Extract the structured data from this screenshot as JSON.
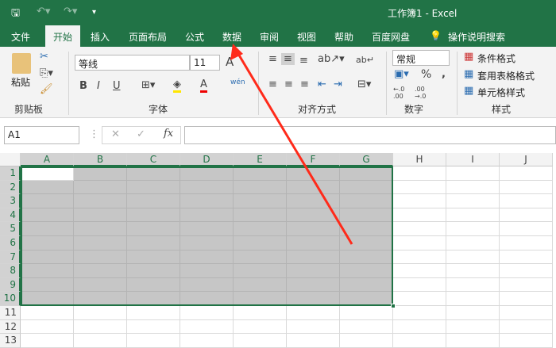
{
  "title": "工作簿1  -  Excel",
  "quick_access": {
    "save_icon": "save-icon",
    "undo_icon": "undo-icon",
    "redo_icon": "redo-icon",
    "customize": "₹"
  },
  "tabs": [
    {
      "label": "文件"
    },
    {
      "label": "开始",
      "active": true
    },
    {
      "label": "插入"
    },
    {
      "label": "页面布局"
    },
    {
      "label": "公式"
    },
    {
      "label": "数据"
    },
    {
      "label": "审阅"
    },
    {
      "label": "视图"
    },
    {
      "label": "帮助"
    },
    {
      "label": "百度网盘"
    },
    {
      "label": "操作说明搜索"
    }
  ],
  "ribbon": {
    "clipboard": {
      "paste": "粘贴",
      "group": "剪贴板"
    },
    "font": {
      "name": "等线",
      "size": "11",
      "group": "字体",
      "bold": "B",
      "italic": "I",
      "underline": "U",
      "grow": "A",
      "shrink": "A",
      "color": "A",
      "phonetic": "wén"
    },
    "alignment": {
      "group": "对齐方式"
    },
    "number": {
      "format": "常规",
      "percent": "%",
      "comma": ",",
      "group": "数字",
      "inc": "←.0 .00",
      "dec": ".00 →.0"
    },
    "styles": {
      "conditional": "条件格式",
      "table": "套用表格格式",
      "cell": "单元格样式",
      "group": "样式"
    }
  },
  "formula_bar": {
    "name_box": "A1",
    "fx": "fx",
    "value": ""
  },
  "columns": [
    "A",
    "B",
    "C",
    "D",
    "E",
    "F",
    "G",
    "H",
    "I",
    "J"
  ],
  "rows": [
    "1",
    "2",
    "3",
    "4",
    "5",
    "6",
    "7",
    "8",
    "9",
    "10",
    "11",
    "12",
    "13"
  ],
  "selection": "A1:G10",
  "colors": {
    "accent": "#217346",
    "selection": "#c6c6c6",
    "arrow": "#ff2a1a"
  }
}
